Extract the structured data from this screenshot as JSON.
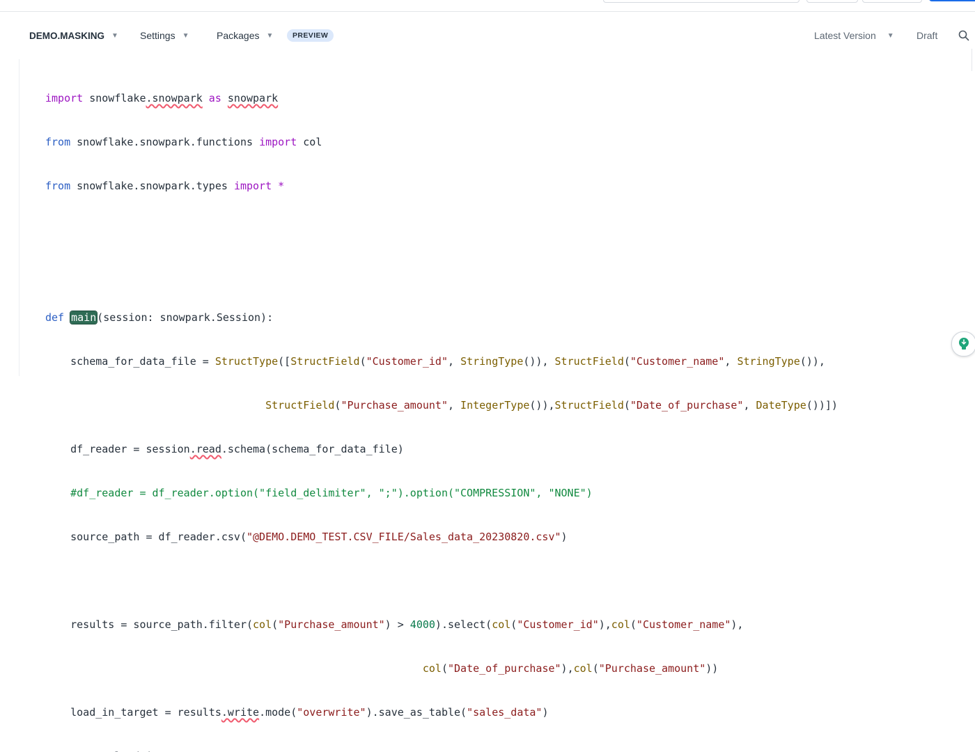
{
  "toolbar": {
    "worksheet_name": "DEMO.MASKING",
    "settings_label": "Settings",
    "packages_label": "Packages",
    "preview_badge": "PREVIEW",
    "version_label": "Latest Version",
    "draft_label": "Draft"
  },
  "icons": {
    "search": "search-icon",
    "lightbulb": "lightbulb-icon",
    "dropdown": "chevron-down-icon"
  },
  "colors": {
    "keyword": "#9d16c2",
    "def_keyword": "#2c5fc4",
    "string": "#8b1c1c",
    "type": "#7b5e00",
    "comment": "#128a40",
    "highlight": "#2f6c55",
    "error_squiggle": "#f05a6e",
    "accent": "#1a6ce8"
  },
  "code": {
    "l1": {
      "a": "import",
      "b": " snowflake",
      "c": ".snowpark",
      "d": " as ",
      "e": "snowpark"
    },
    "l2": {
      "a": "from",
      "b": " snowflake.snowpark.functions ",
      "c": "import",
      "d": " col"
    },
    "l3": {
      "a": "from",
      "b": " snowflake.snowpark.types ",
      "c": "import",
      "d": " *"
    },
    "l6": {
      "a": "def",
      "b": " ",
      "c": "main",
      "d": "(session: snowpark.Session):"
    },
    "l7": {
      "a": "    schema_for_data_file = ",
      "b": "StructType",
      "c": "([",
      "d": "StructField",
      "e": "(",
      "f": "\"Customer_id\"",
      "g": ", ",
      "h": "StringType",
      "i": "()), ",
      "j": "StructField",
      "k": "(",
      "l": "\"Customer_name\"",
      "m": ", ",
      "n": "StringType",
      "o": "()),"
    },
    "l8": {
      "a": "                                   ",
      "b": "StructField",
      "c": "(",
      "d": "\"Purchase_amount\"",
      "e": ", ",
      "f": "IntegerType",
      "g": "()),",
      "h": "StructField",
      "i": "(",
      "j": "\"Date_of_purchase\"",
      "k": ", ",
      "l": "DateType",
      "m": "())])"
    },
    "l9": {
      "a": "    df_reader = session",
      "b": ".read",
      "c": ".schema(schema_for_data_file)"
    },
    "l10": {
      "a": "    #df_reader = df_reader.option(\"field_delimiter\", \";\").option(\"COMPRESSION\", \"NONE\")"
    },
    "l11": {
      "a": "    source_path = df_reader.csv(",
      "b": "\"@DEMO.DEMO_TEST.CSV_FILE/Sales_data_20230820.csv\"",
      "c": ")"
    },
    "l13": {
      "a": "    results = source_path.filter(",
      "b": "col",
      "c": "(",
      "d": "\"Purchase_amount\"",
      "e": ") > ",
      "f": "4000",
      "g": ").select(",
      "h": "col",
      "i": "(",
      "j": "\"Customer_id\"",
      "k": "),",
      "l": "col",
      "m": "(",
      "n": "\"Customer_name\"",
      "o": "),"
    },
    "l14": {
      "a": "                                                            ",
      "b": "col",
      "c": "(",
      "d": "\"Date_of_purchase\"",
      "e": "),",
      "f": "col",
      "g": "(",
      "h": "\"Purchase_amount\"",
      "i": "))"
    },
    "l15": {
      "a": "    load_in_target = results",
      "b": ".write",
      "c": ".mode(",
      "d": "\"overwrite\"",
      "e": ").save_as_table(",
      "f": "\"sales_data\"",
      "g": ")"
    },
    "l16": {
      "a": "    ",
      "b": "return",
      "c": " load_in_target"
    }
  }
}
